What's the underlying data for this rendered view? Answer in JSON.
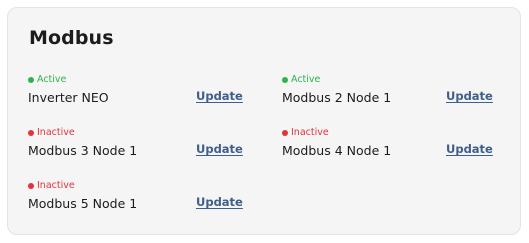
{
  "card": {
    "title": "Modbus"
  },
  "colors": {
    "active": "#2db34a",
    "inactive": "#e0333b",
    "link": "#3e5f8a"
  },
  "devices": [
    {
      "status": "Active",
      "name": "Inverter NEO",
      "action": "Update"
    },
    {
      "status": "Active",
      "name": "Modbus 2 Node 1",
      "action": "Update"
    },
    {
      "status": "Inactive",
      "name": "Modbus 3 Node 1",
      "action": "Update"
    },
    {
      "status": "Inactive",
      "name": "Modbus 4 Node 1",
      "action": "Update"
    },
    {
      "status": "Inactive",
      "name": "Modbus 5 Node 1",
      "action": "Update"
    }
  ]
}
